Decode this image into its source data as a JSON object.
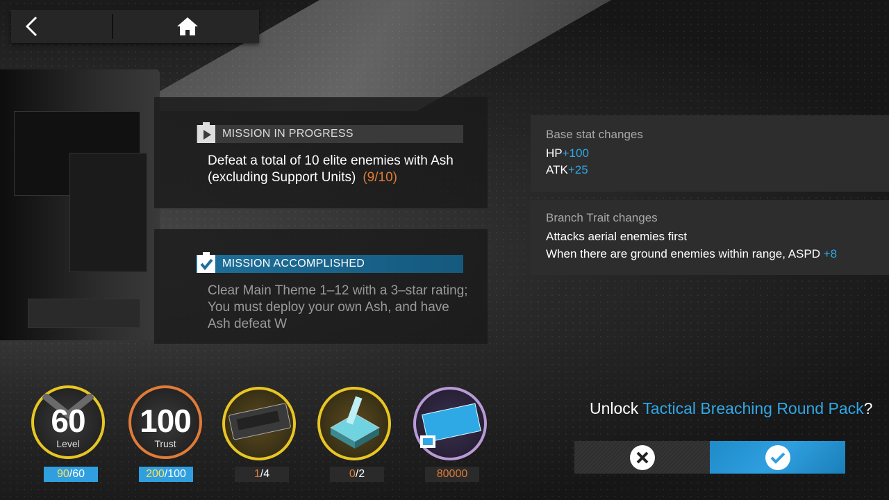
{
  "nav": {
    "back_icon": "chevron-left-icon",
    "home_icon": "home-icon"
  },
  "missions": [
    {
      "status": "MISSION IN PROGRESS",
      "text_line1": "Defeat a total of 10 elite enemies with Ash",
      "text_line2": "(excluding Support Units)",
      "progress": "(9/10)",
      "icon": "play-clipboard-icon"
    },
    {
      "status": "MISSION ACCOMPLISHED",
      "text_line1": "Clear Main Theme 1–12 with a 3–star rating;",
      "text_line2": "You must deploy your own Ash, and have",
      "text_line3": "Ash defeat W",
      "icon": "check-clipboard-icon"
    }
  ],
  "stats": {
    "base_title": "Base stat changes",
    "hp_label": "HP",
    "hp_value": "+100",
    "atk_label": "ATK",
    "atk_value": "+25",
    "branch_title": "Branch Trait changes",
    "trait1": "Attacks aerial enemies first",
    "trait2_text": "When there are ground enemies within range, ASPD ",
    "trait2_value": "+8"
  },
  "requirements": {
    "level": {
      "value": "60",
      "label": "Level",
      "have": "90",
      "need": "/60"
    },
    "trust": {
      "value": "100",
      "label": "Trust",
      "have": "200",
      "need": "/100"
    },
    "item1": {
      "have": "1",
      "need": "/4",
      "icon": "raytheon-module-icon"
    },
    "item2": {
      "have": "0",
      "need": "/2",
      "icon": "data-crystal-icon"
    },
    "item3": {
      "count": "80000",
      "icon": "lmd-ticket-icon"
    }
  },
  "confirm": {
    "prefix": "Unlock ",
    "item": "Tactical Breaching Round Pack",
    "suffix": "?",
    "cancel_icon": "close-icon",
    "ok_icon": "check-icon"
  },
  "colors": {
    "accent_blue": "#2fa8e6",
    "orange": "#e07b38",
    "gold": "#e8c623"
  }
}
